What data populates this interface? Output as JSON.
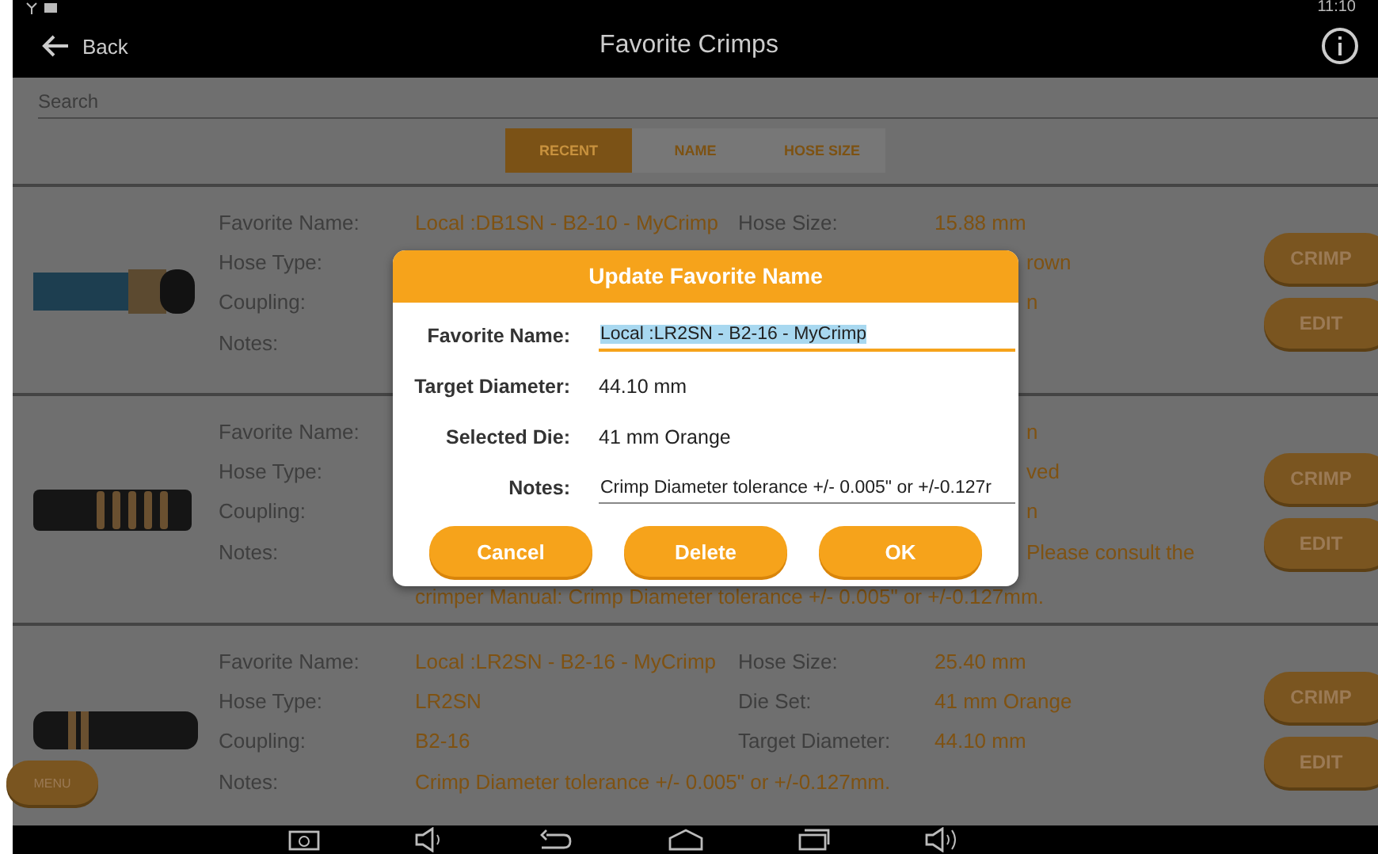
{
  "status_bar": {
    "time": "11:10"
  },
  "app_bar": {
    "back": "Back",
    "title": "Favorite Crimps"
  },
  "search": {
    "placeholder": "Search"
  },
  "tabs": [
    {
      "label": "RECENT",
      "selected": true
    },
    {
      "label": "NAME",
      "selected": false
    },
    {
      "label": "HOSE SIZE",
      "selected": false
    }
  ],
  "cards": [
    {
      "rows": [
        {
          "kind": "full",
          "label": "Favorite Name:",
          "value": "Local :DB1SN - B2-10 - MyCrimp",
          "label2": "Hose Size:",
          "value2": "15.88 mm"
        },
        {
          "kind": "partial",
          "label": "Hose Type:",
          "value2": "rown"
        },
        {
          "kind": "partial",
          "label": "Coupling:",
          "value2": "n"
        }
      ],
      "notes": {
        "label": "Notes:"
      },
      "buttons": [
        "CRIMP",
        "EDIT"
      ]
    },
    {
      "rows": [
        {
          "kind": "partial",
          "label": "Favorite Name:",
          "value2": "n"
        },
        {
          "kind": "partial",
          "label": "Hose Type:",
          "value2": "ved"
        },
        {
          "kind": "partial",
          "label": "Coupling:",
          "value2": "n"
        }
      ],
      "notes": {
        "label": "Notes:",
        "lines": [
          {
            "kind": "partial",
            "text": "Please consult the"
          },
          {
            "kind": "full",
            "text": "crimper Manual:  Crimp Diameter tolerance +/- 0.005\" or +/-0.127mm."
          }
        ]
      },
      "buttons": [
        "CRIMP",
        "EDIT"
      ]
    },
    {
      "rows": [
        {
          "kind": "full",
          "label": "Favorite Name:",
          "value": "Local :LR2SN - B2-16 - MyCrimp",
          "label2": "Hose Size:",
          "value2": "25.40 mm"
        },
        {
          "kind": "full",
          "label": "Hose Type:",
          "value": "LR2SN",
          "label2": "Die Set:",
          "value2": "41 mm Orange"
        },
        {
          "kind": "full",
          "label": "Coupling:",
          "value": "B2-16",
          "label2": "Target Diameter:",
          "value2": "44.10 mm"
        }
      ],
      "notes": {
        "label": "Notes:",
        "lines": [
          {
            "kind": "full",
            "text": "Crimp Diameter tolerance +/- 0.005\" or +/-0.127mm."
          }
        ]
      },
      "buttons": [
        "CRIMP",
        "EDIT"
      ]
    }
  ],
  "menu_button": "MENU",
  "dialog": {
    "title": "Update Favorite Name",
    "fields": [
      {
        "kind": "input",
        "label": "Favorite Name:",
        "value": "Local :LR2SN - B2-16 - MyCrimp",
        "selected": true
      },
      {
        "kind": "text",
        "label": "Target Diameter:",
        "value": "44.10 mm"
      },
      {
        "kind": "text",
        "label": "Selected Die:",
        "value": "41 mm Orange"
      },
      {
        "kind": "input",
        "label": "Notes:",
        "value": "Crimp Diameter tolerance +/- 0.005\" or +/-0.127r",
        "selected": false
      }
    ],
    "buttons": [
      "Cancel",
      "Delete",
      "OK"
    ]
  }
}
